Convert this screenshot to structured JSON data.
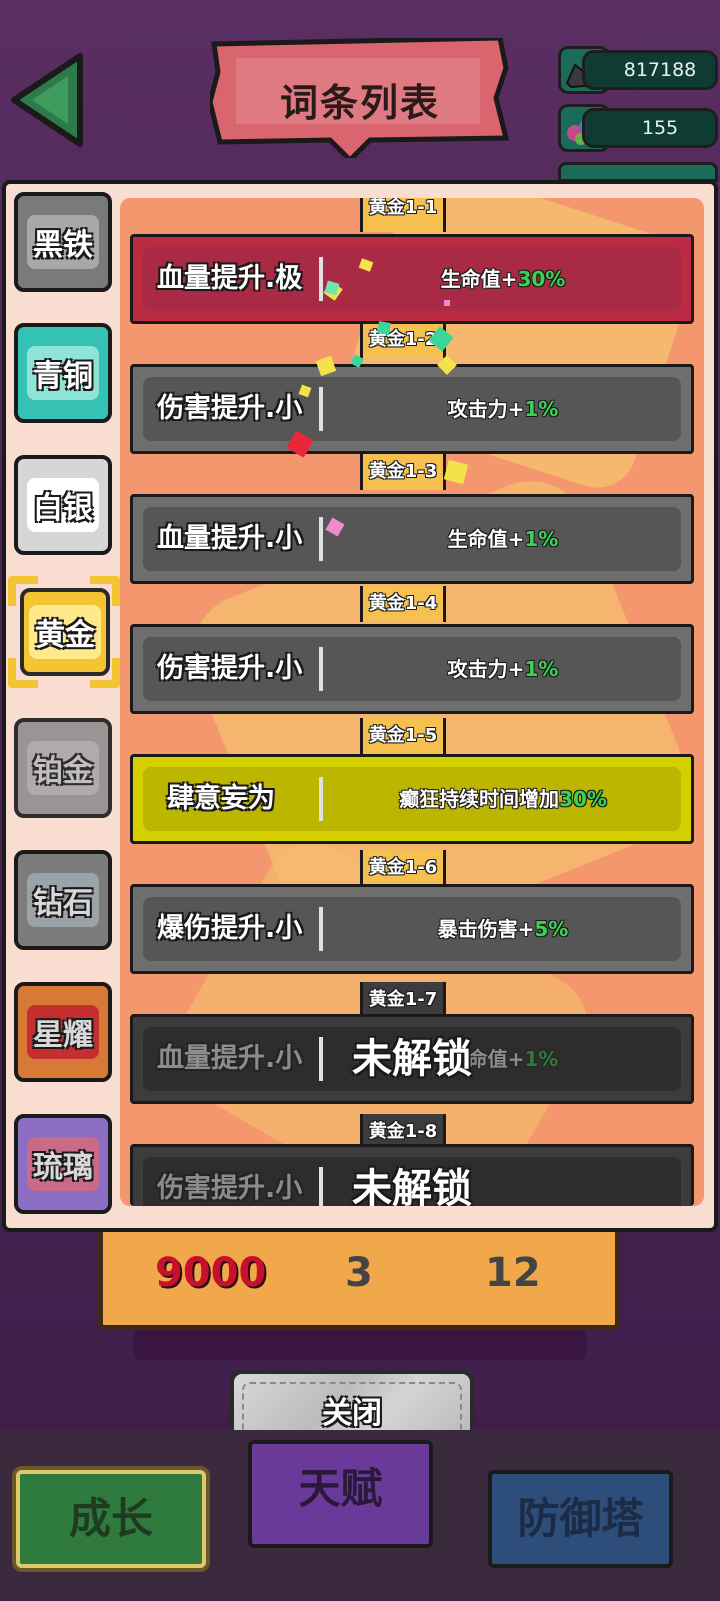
{
  "header": {
    "title": "词条列表"
  },
  "resources": [
    {
      "icon": "ore-pile-icon",
      "value": "817188"
    },
    {
      "icon": "gem-pile-icon",
      "value": "155"
    }
  ],
  "costs": {
    "iron": "9000",
    "gem": "3",
    "gold": "12"
  },
  "tabs": [
    {
      "label": "黑铁"
    },
    {
      "label": "青铜"
    },
    {
      "label": "白银"
    },
    {
      "label": "黄金",
      "selected": true
    },
    {
      "label": "铂金"
    },
    {
      "label": "钻石"
    },
    {
      "label": "星耀"
    },
    {
      "label": "琉璃"
    }
  ],
  "levels": [
    "黄金1-1",
    "黄金1-2",
    "黄金1-3",
    "黄金1-4",
    "黄金1-5",
    "黄金1-6",
    "黄金1-7",
    "黄金1-8"
  ],
  "rows": [
    {
      "name": "血量提升.极",
      "effect": "生命值+",
      "value": "30%",
      "style": "red"
    },
    {
      "name": "伤害提升.小",
      "effect": "攻击力+",
      "value": "1%",
      "style": "gray"
    },
    {
      "name": "血量提升.小",
      "effect": "生命值+",
      "value": "1%",
      "style": "gray"
    },
    {
      "name": "伤害提升.小",
      "effect": "攻击力+",
      "value": "1%",
      "style": "gray"
    },
    {
      "name": "肆意妄为",
      "effect": "癫狂持续时间增加",
      "value": "30%",
      "style": "yellow"
    },
    {
      "name": "爆伤提升.小",
      "effect": "暴击伤害+",
      "value": "5%",
      "style": "gray"
    },
    {
      "name": "血量提升.小",
      "effect": "生命值+",
      "value": "1%",
      "style": "locked"
    },
    {
      "name": "伤害提升.小",
      "effect": "",
      "value": "",
      "style": "locked"
    }
  ],
  "locked_label": "未解锁",
  "close_label": "关闭",
  "bottom_nav": [
    {
      "label": "成长",
      "active": true
    },
    {
      "label": "天赋"
    },
    {
      "label": "防御塔"
    }
  ],
  "colors": {
    "bonus_green": "#39d353",
    "red_row": "#bb2c44",
    "yellow_row": "#d4d000",
    "gray_row": "#6e6e6e",
    "panel_orange": "#f4966e"
  }
}
